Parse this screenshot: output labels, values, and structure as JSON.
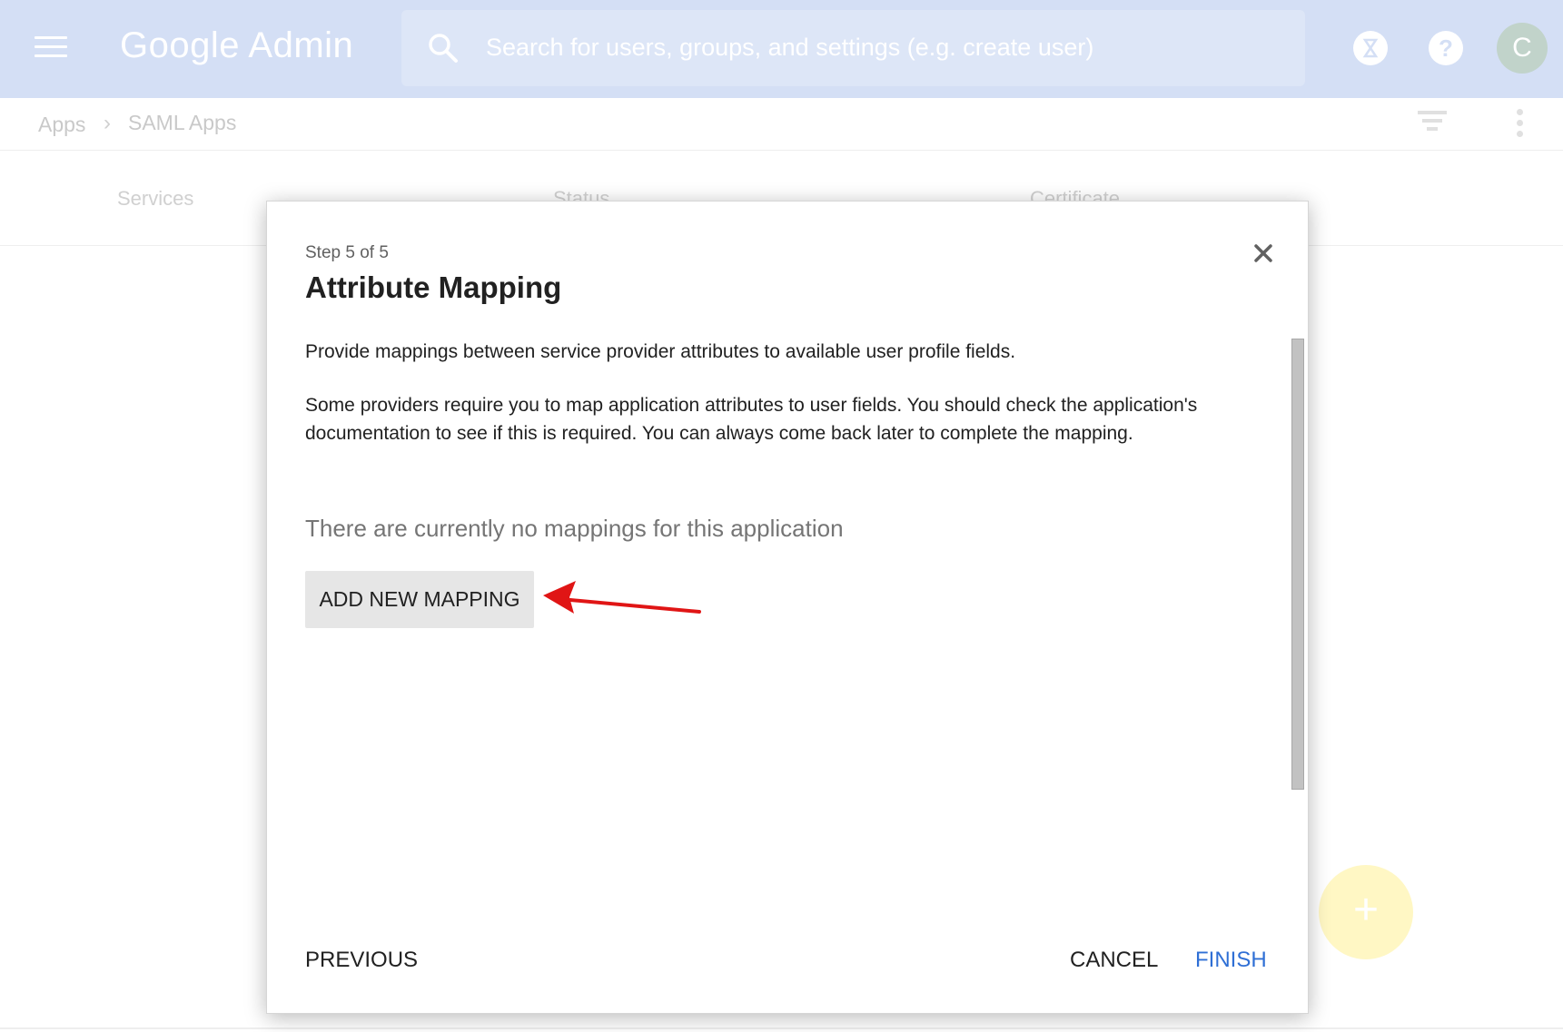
{
  "header": {
    "brand": "Google Admin",
    "search_placeholder": "Search for users, groups, and settings (e.g. create user)",
    "avatar_initial": "C"
  },
  "breadcrumb": {
    "items": [
      "Apps",
      "SAML Apps"
    ]
  },
  "table": {
    "columns": [
      "Services",
      "Status",
      "Certificate"
    ]
  },
  "dialog": {
    "step": "Step 5 of 5",
    "title": "Attribute Mapping",
    "description": "Provide mappings between service provider attributes to available user profile fields.",
    "note": "Some providers require you to map application attributes to user fields. You should check the application's documentation to see if this is required. You can always come back later to complete the mapping.",
    "empty_state": "There are currently no mappings for this application",
    "add_button": "ADD NEW MAPPING",
    "previous_button": "PREVIOUS",
    "cancel_button": "CANCEL",
    "finish_button": "FINISH"
  },
  "fab": {
    "label": "+"
  },
  "colors": {
    "topbar": "#d4dff5",
    "accent_blue": "#2f6fd5",
    "annotation_red": "#e01515",
    "fab_yellow": "#fff7c4"
  },
  "icons": [
    "menu-icon",
    "search-icon",
    "hourglass-icon",
    "help-icon",
    "filter-icon",
    "more-vert-icon",
    "close-icon",
    "add-icon",
    "arrow-annotation"
  ]
}
